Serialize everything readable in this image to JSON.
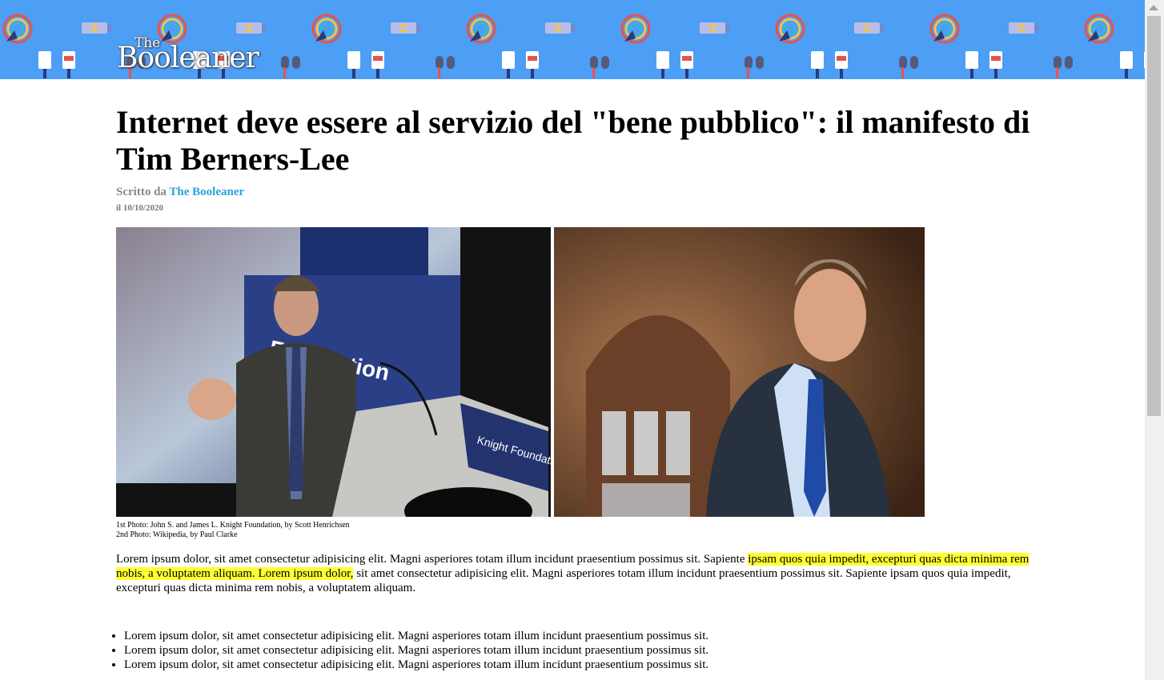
{
  "header": {
    "logo_the": "The",
    "logo_name": "Booleaner",
    "brand_color": "#4d9ef5"
  },
  "article": {
    "title": "Internet deve essere al servizio del \"bene pubblico\": il manifesto di Tim Berners-Lee",
    "byline_prefix": "Scritto da",
    "author": "The Booleaner",
    "date": "il 10/10/2020",
    "caption_line1": "1st Photo: John S. and James L. Knight Foundation, by Scott Henrichsen",
    "caption_line2": "2nd Photo: Wikipedia, by Paul Clarke",
    "photo1_podium_text": "Knight Foundation",
    "paragraph": {
      "before": "Lorem ipsum dolor, sit amet consectetur adipisicing elit. Magni asperiores totam illum incidunt praesentium possimus sit. Sapiente ",
      "highlight": "ipsam quos quia impedit, excepturi quas dicta minima rem nobis, a voluptatem aliquam. Lorem ipsum dolor,",
      "after": " sit amet consectetur adipisicing elit. Magni asperiores totam illum incidunt praesentium possimus sit. Sapiente ipsam quos quia impedit, excepturi quas dicta minima rem nobis, a voluptatem aliquam."
    },
    "list_items": [
      "Lorem ipsum dolor, sit amet consectetur adipisicing elit. Magni asperiores totam illum incidunt praesentium possimus sit.",
      "Lorem ipsum dolor, sit amet consectetur adipisicing elit. Magni asperiores totam illum incidunt praesentium possimus sit.",
      "Lorem ipsum dolor, sit amet consectetur adipisicing elit. Magni asperiores totam illum incidunt praesentium possimus sit."
    ],
    "highlight_color": "#ffff33",
    "author_link_color": "#2aa0dc"
  }
}
